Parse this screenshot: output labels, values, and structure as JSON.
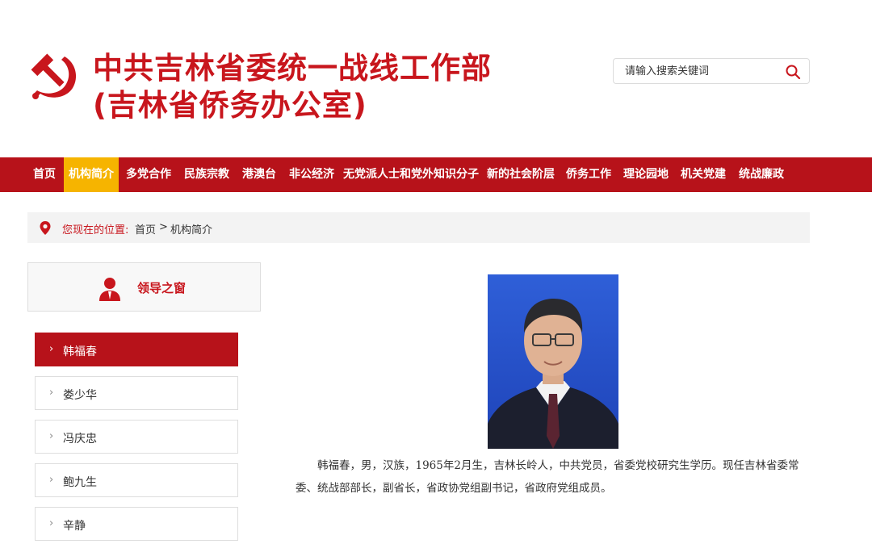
{
  "header": {
    "title_line1": "中共吉林省委统一战线工作部",
    "title_line2": "(吉林省侨务办公室)",
    "emblem_icon": "hammer-sickle-icon",
    "brand_color": "#c8161d"
  },
  "search": {
    "placeholder": "请输入搜索关键词",
    "icon": "search-icon"
  },
  "nav": {
    "items": [
      {
        "label": "首页"
      },
      {
        "label": "机构简介"
      },
      {
        "label": "多党合作"
      },
      {
        "label": "民族宗教"
      },
      {
        "label": "港澳台"
      },
      {
        "label": "非公经济"
      },
      {
        "label": "无党派人士和党外知识分子"
      },
      {
        "label": "新的社会阶层"
      },
      {
        "label": "侨务工作"
      },
      {
        "label": "理论园地"
      },
      {
        "label": "机关党建"
      },
      {
        "label": "统战廉政"
      }
    ],
    "active_index": 1,
    "background": "#b7121a",
    "active_color": "#f6b400"
  },
  "breadcrumb": {
    "label": "您现在的位置:",
    "home": "首页",
    "separator": ">",
    "current": "机构简介",
    "icon": "location-pin-icon"
  },
  "sidebar": {
    "title": "领导之窗",
    "icon": "person-icon",
    "leaders": [
      {
        "name": "韩福春"
      },
      {
        "name": "娄少华"
      },
      {
        "name": "冯庆忠"
      },
      {
        "name": "鲍九生"
      },
      {
        "name": "辛静"
      }
    ],
    "active_index": 0,
    "chevron": "›"
  },
  "content": {
    "bio": "韩福春，男，汉族，1965年2月生，吉林长岭人，中共党员，省委党校研究生学历。现任吉林省委常委、统战部部长，副省长，省政协党组副书记，省政府党组成员。"
  }
}
